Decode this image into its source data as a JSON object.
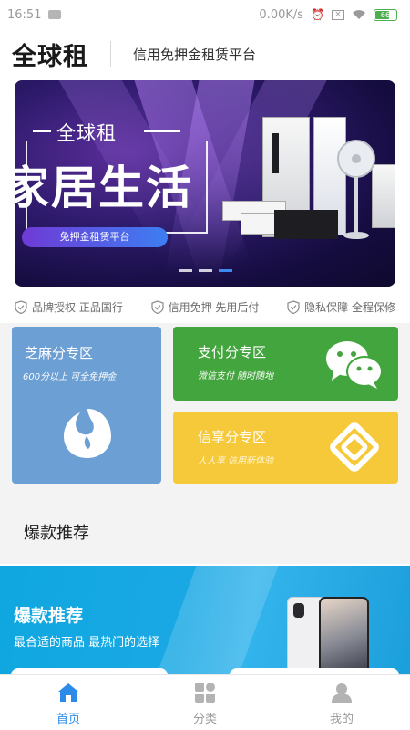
{
  "status_bar": {
    "time": "16:51",
    "network_speed": "0.00K/s",
    "battery": "66"
  },
  "header": {
    "title": "全球租",
    "subtitle": "信用免押金租赁平台"
  },
  "banner": {
    "small_title": "全球租",
    "big_title": "家居生活",
    "pill": "免押金租赁平台",
    "slide_count": 3,
    "active_slide": 3
  },
  "guarantees": [
    {
      "label": "品牌授权 正品国行"
    },
    {
      "label": "信用免押 先用后付"
    },
    {
      "label": "隐私保障 全程保修"
    }
  ],
  "zones": {
    "sesame": {
      "title": "芝麻分专区",
      "desc": "600分以上 可全免押金",
      "color": "#6c9fd3"
    },
    "pay": {
      "title": "支付分专区",
      "desc": "微信支付 随时随地",
      "color": "#43a53e"
    },
    "credit": {
      "title": "信享分专区",
      "desc": "人人享 信用新体验",
      "color": "#f5c93a"
    }
  },
  "section": {
    "title": "爆款推荐"
  },
  "promo": {
    "title": "爆款推荐",
    "subtitle": "最合适的商品 最热门的选择"
  },
  "bottom_nav": [
    {
      "label": "首页",
      "icon": "home-icon",
      "active": true
    },
    {
      "label": "分类",
      "icon": "category-icon",
      "active": false
    },
    {
      "label": "我的",
      "icon": "profile-icon",
      "active": false
    }
  ],
  "colors": {
    "accent": "#2c8be8",
    "banner_dot_active": "#3f88f0"
  }
}
